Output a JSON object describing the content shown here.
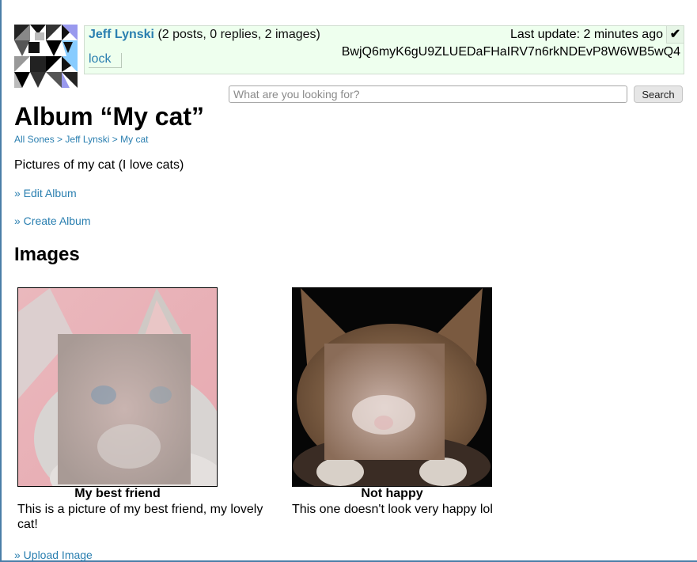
{
  "sone": {
    "name": "Jeff Lynski",
    "stats": "(2 posts, 0 replies, 2 images)",
    "last_update": "Last update: 2 minutes ago",
    "checkmark": "✔",
    "lock_label": "lock",
    "id": "BwjQ6myK6gU9ZLUEDaFHaIRV7n6rkNDEvP8W6WB5wQ4"
  },
  "search": {
    "placeholder": "What are you looking for?",
    "button_label": "Search"
  },
  "album": {
    "title": "Album “My cat”",
    "breadcrumb": {
      "items": [
        "All Sones",
        "Jeff Lynski",
        "My cat"
      ],
      "separator": ">"
    },
    "description": "Pictures of my cat (I love cats)",
    "edit_label": "» Edit Album",
    "create_label": "» Create Album"
  },
  "images_section": {
    "title": "Images",
    "upload_label": "» Upload Image",
    "images": [
      {
        "title": "My best friend",
        "description": "This is a picture of my best friend, my lovely cat!"
      },
      {
        "title": "Not happy",
        "description": "This one doesn't look very happy lol"
      }
    ]
  },
  "colors": {
    "link": "#2a7fb0",
    "status_background": "#eeffee",
    "page_rule": "#4a7ea8"
  }
}
